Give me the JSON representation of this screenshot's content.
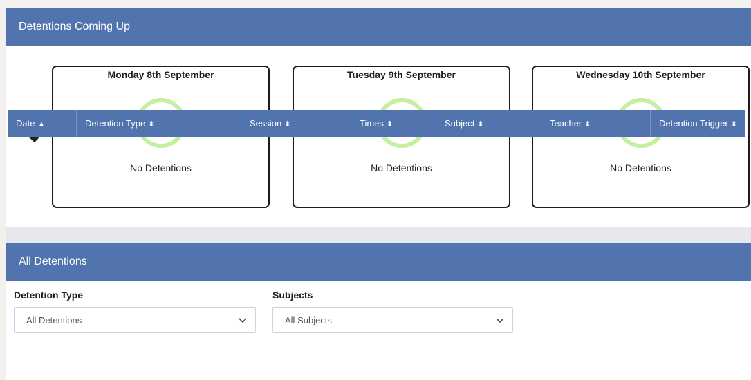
{
  "upcoming": {
    "title": "Detentions Coming Up",
    "days": [
      {
        "title": "Monday 8th September",
        "status": "No Detentions"
      },
      {
        "title": "Tuesday 9th September",
        "status": "No Detentions"
      },
      {
        "title": "Wednesday 10th September",
        "status": "No Detentions"
      }
    ]
  },
  "all_detentions": {
    "title": "All Detentions",
    "filters": {
      "detention_type": {
        "label": "Detention Type",
        "value": "All Detentions"
      },
      "subjects": {
        "label": "Subjects",
        "value": "All Subjects"
      }
    },
    "columns": [
      {
        "label": "Date",
        "sort": "asc"
      },
      {
        "label": "Detention Type",
        "sort": "both"
      },
      {
        "label": "Session",
        "sort": "both"
      },
      {
        "label": "Times",
        "sort": "both"
      },
      {
        "label": "Subject",
        "sort": "both"
      },
      {
        "label": "Teacher",
        "sort": "both"
      },
      {
        "label": "Detention Trigger",
        "sort": "both"
      }
    ]
  },
  "colors": {
    "header_blue": "#5274ae",
    "smiley_green": "#c8eea0",
    "background": "#f2f1ee"
  },
  "icons": {
    "prev": "chevron-left-icon",
    "smiley": "smiley-icon",
    "dropdown": "chevron-down-icon",
    "sort": "sort-icon"
  }
}
